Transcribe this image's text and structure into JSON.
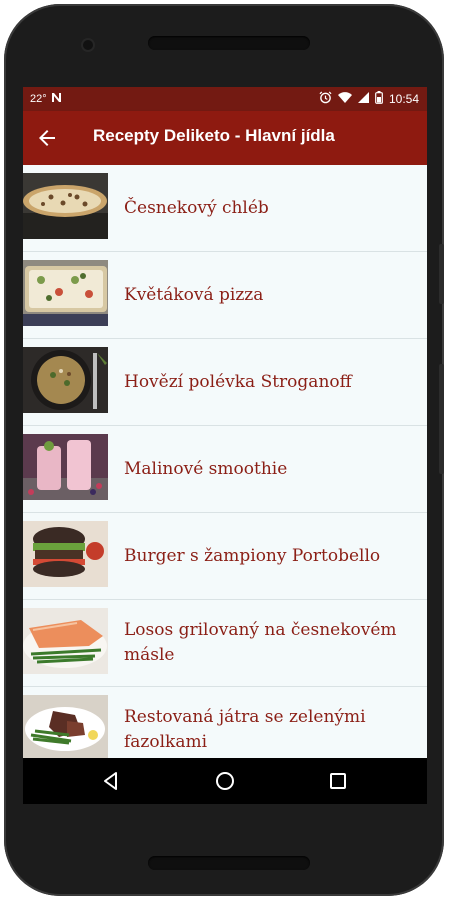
{
  "status_bar": {
    "temperature": "22°",
    "notification_icon": "n-icon",
    "time": "10:54"
  },
  "app_bar": {
    "title": "Recepty Deliketo - Hlavní jídla"
  },
  "recipes": [
    {
      "title": "Česnekový chléb",
      "thumb": "garlic-bread"
    },
    {
      "title": "Květáková pizza",
      "thumb": "cauliflower-pizza"
    },
    {
      "title": "Hovězí polévka Stroganoff",
      "thumb": "soup"
    },
    {
      "title": "Malinové smoothie",
      "thumb": "smoothie"
    },
    {
      "title": "Burger s žampiony Portobello",
      "thumb": "burger"
    },
    {
      "title": "Losos grilovaný na česnekovém másle",
      "thumb": "salmon"
    },
    {
      "title": "Restovaná játra se zelenými fazolkami",
      "thumb": "liver"
    }
  ],
  "colors": {
    "app_bar": "#8e1a10",
    "status_bar": "#731a12",
    "item_text": "#8b1f16",
    "list_background": "#f4fafb"
  }
}
